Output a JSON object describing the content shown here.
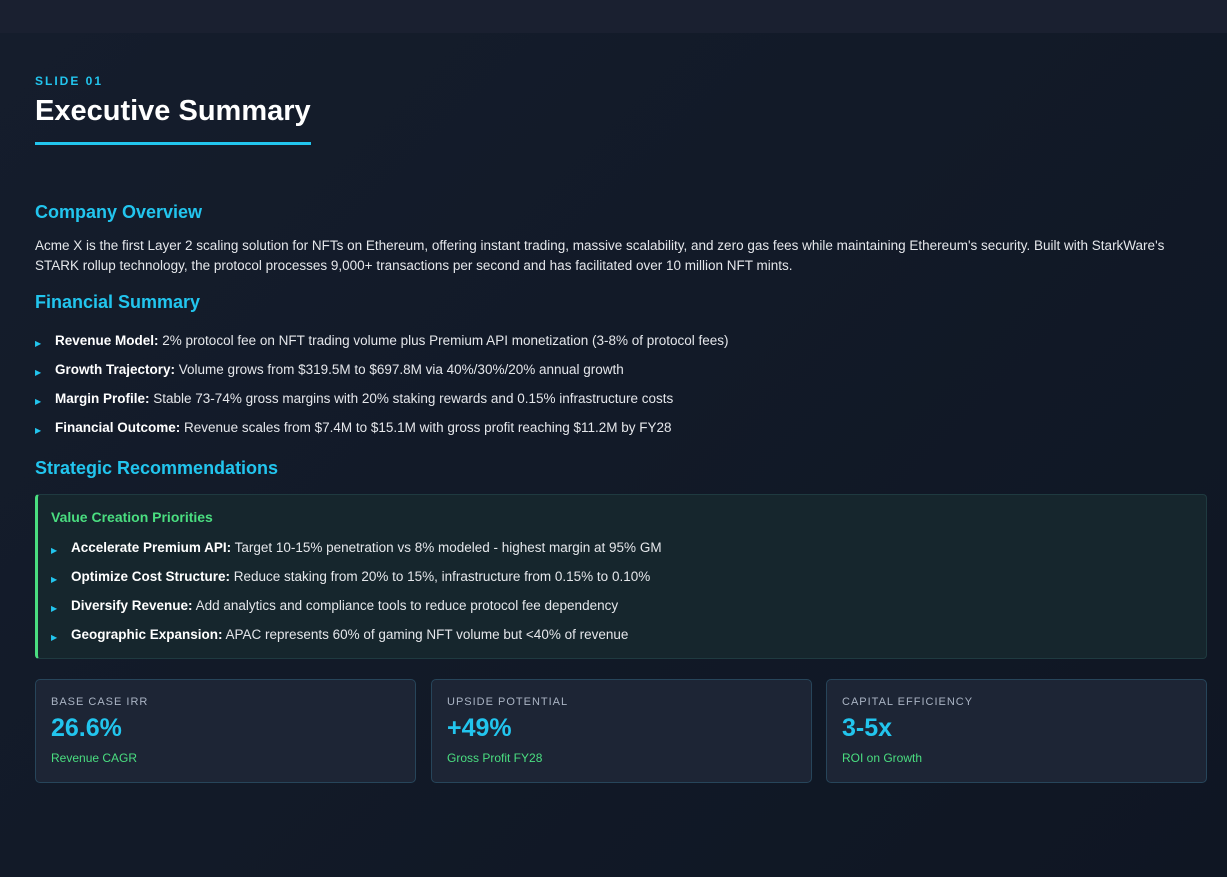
{
  "slide": {
    "number": "SLIDE 01",
    "title": "Executive Summary"
  },
  "company_overview": {
    "heading": "Company Overview",
    "text": "Acme X is the first Layer 2 scaling solution for NFTs on Ethereum, offering instant trading, massive scalability, and zero gas fees while maintaining Ethereum's security. Built with StarkWare's STARK rollup technology, the protocol processes 9,000+ transactions per second and has facilitated over 10 million NFT mints."
  },
  "financial_summary": {
    "heading": "Financial Summary",
    "items": [
      {
        "label": "Revenue Model:",
        "text": " 2% protocol fee on NFT trading volume plus Premium API monetization (3-8% of protocol fees)"
      },
      {
        "label": "Growth Trajectory:",
        "text": " Volume grows from $319.5M to $697.8M via 40%/30%/20% annual growth"
      },
      {
        "label": "Margin Profile:",
        "text": " Stable 73-74% gross margins with 20% staking rewards and 0.15% infrastructure costs"
      },
      {
        "label": "Financial Outcome:",
        "text": " Revenue scales from $7.4M to $15.1M with gross profit reaching $11.2M by FY28"
      }
    ]
  },
  "strategic_recommendations": {
    "heading": "Strategic Recommendations",
    "box_title": "Value Creation Priorities",
    "items": [
      {
        "label": "Accelerate Premium API:",
        "text": " Target 10-15% penetration vs 8% modeled - highest margin at 95% GM"
      },
      {
        "label": "Optimize Cost Structure:",
        "text": " Reduce staking from 20% to 15%, infrastructure from 0.15% to 0.10%"
      },
      {
        "label": "Diversify Revenue:",
        "text": " Add analytics and compliance tools to reduce protocol fee dependency"
      },
      {
        "label": "Geographic Expansion:",
        "text": " APAC represents 60% of gaming NFT volume but <40% of revenue"
      }
    ]
  },
  "metrics": [
    {
      "label": "BASE CASE IRR",
      "value": "26.6%",
      "sub": "Revenue CAGR"
    },
    {
      "label": "UPSIDE POTENTIAL",
      "value": "+49%",
      "sub": "Gross Profit FY28"
    },
    {
      "label": "CAPITAL EFFICIENCY",
      "value": "3-5x",
      "sub": "ROI on Growth"
    }
  ],
  "bullet_marker": "▶",
  "colors": {
    "accent": "#22c5ee",
    "positive": "#4ade80",
    "background": "#111827"
  }
}
